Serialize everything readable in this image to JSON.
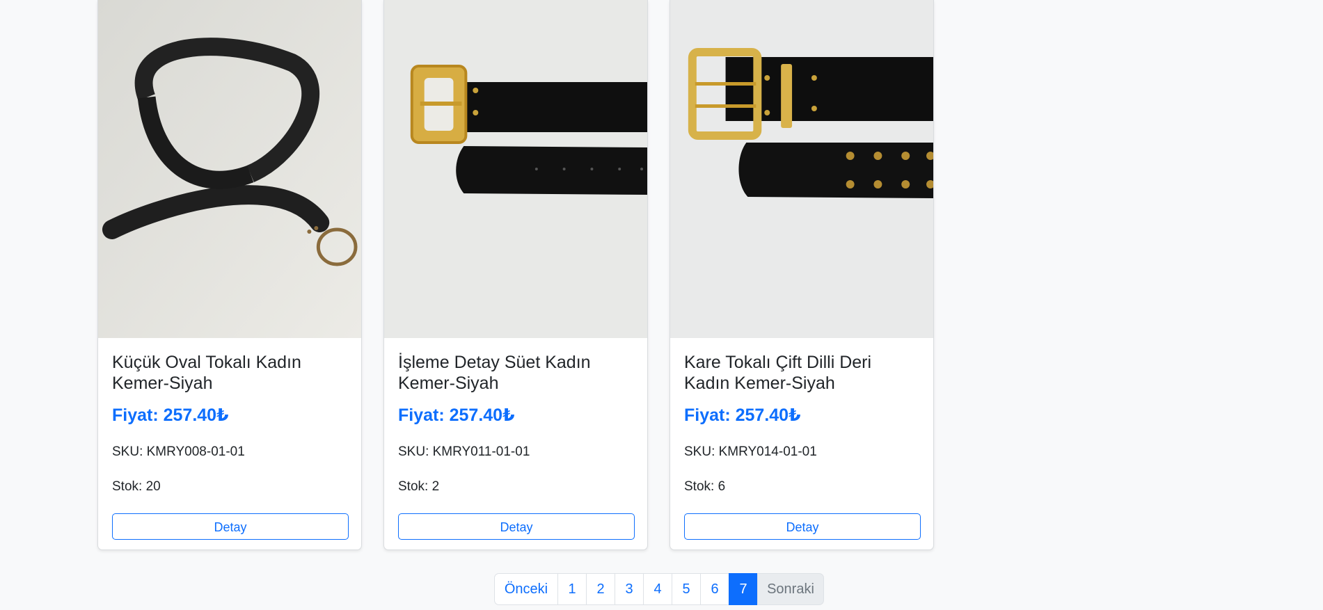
{
  "products": [
    {
      "title": "Küçük Oval Tokalı Kadın Kemer-Siyah",
      "price": "Fiyat: 257.40₺",
      "sku": "SKU: KMRY008-01-01",
      "stock": "Stok: 20",
      "button": "Detay"
    },
    {
      "title": "İşleme Detay Süet Kadın Kemer-Siyah",
      "price": "Fiyat: 257.40₺",
      "sku": "SKU: KMRY011-01-01",
      "stock": "Stok: 2",
      "button": "Detay"
    },
    {
      "title": "Kare Tokalı Çift Dilli Deri Kadın Kemer-Siyah",
      "price": "Fiyat: 257.40₺",
      "sku": "SKU: KMRY014-01-01",
      "stock": "Stok: 6",
      "button": "Detay"
    }
  ],
  "pagination": {
    "prev": "Önceki",
    "pages": [
      "1",
      "2",
      "3",
      "4",
      "5",
      "6",
      "7"
    ],
    "active": "7",
    "next": "Sonraki"
  },
  "colors": {
    "primary": "#0d6efd",
    "background": "#f8f9fa"
  }
}
